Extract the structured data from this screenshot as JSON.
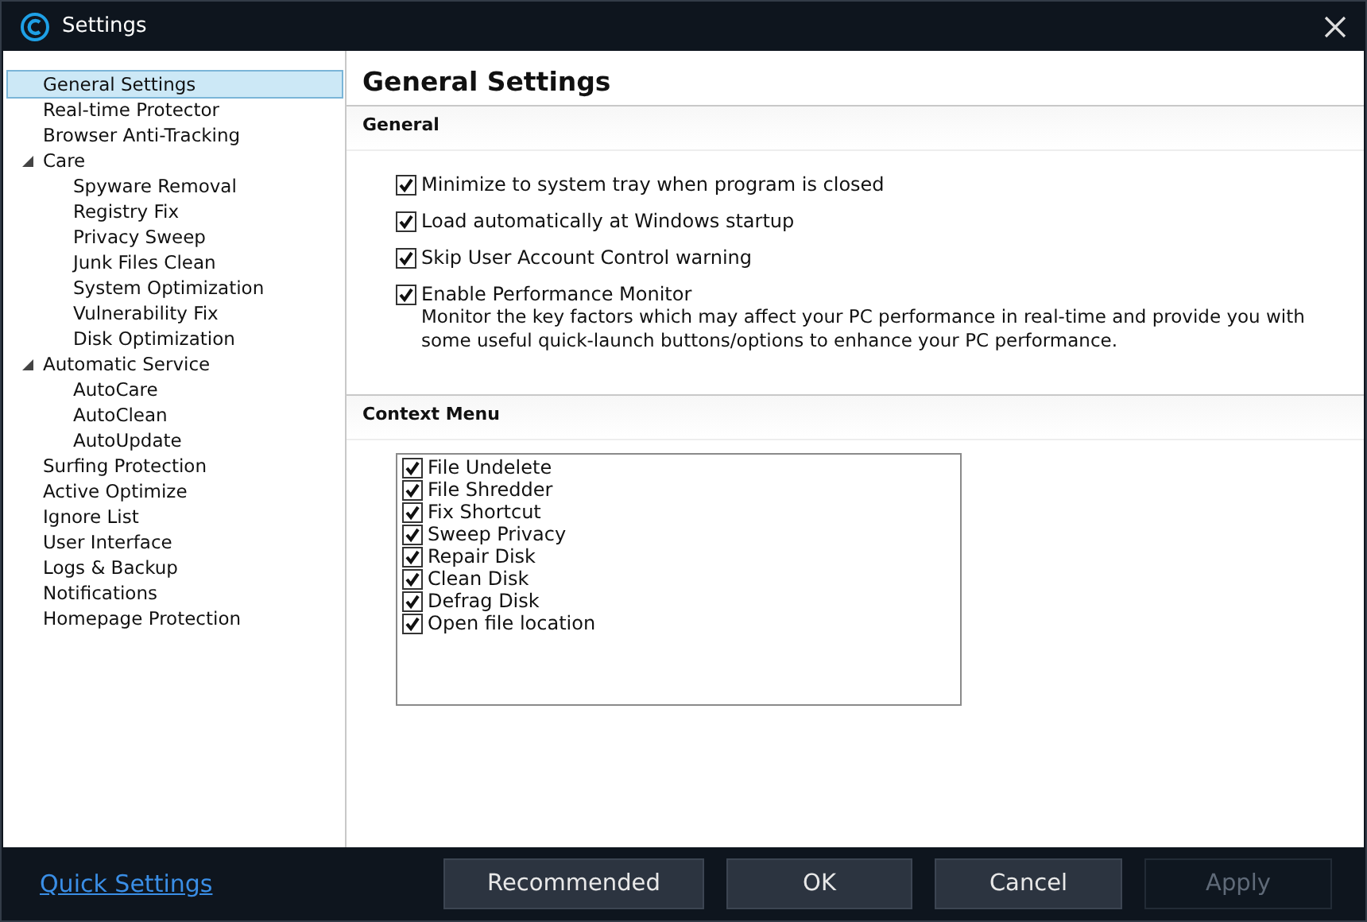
{
  "window": {
    "title": "Settings"
  },
  "sidebar": {
    "items": [
      {
        "label": "General Settings",
        "selected": true
      },
      {
        "label": "Real-time Protector",
        "selected": false
      },
      {
        "label": "Browser Anti-Tracking",
        "selected": false
      },
      {
        "label": "Care",
        "selected": false,
        "expanded": true,
        "children": [
          {
            "label": "Spyware Removal",
            "selected": false
          },
          {
            "label": "Registry Fix",
            "selected": false
          },
          {
            "label": "Privacy Sweep",
            "selected": false
          },
          {
            "label": "Junk Files Clean",
            "selected": false
          },
          {
            "label": "System Optimization",
            "selected": false
          },
          {
            "label": "Vulnerability Fix",
            "selected": false
          },
          {
            "label": "Disk Optimization",
            "selected": false
          }
        ]
      },
      {
        "label": "Automatic Service",
        "selected": false,
        "expanded": true,
        "children": [
          {
            "label": "AutoCare",
            "selected": false
          },
          {
            "label": "AutoClean",
            "selected": false
          },
          {
            "label": "AutoUpdate",
            "selected": false
          }
        ]
      },
      {
        "label": "Surfing Protection",
        "selected": false
      },
      {
        "label": "Active Optimize",
        "selected": false
      },
      {
        "label": "Ignore List",
        "selected": false
      },
      {
        "label": "User Interface",
        "selected": false
      },
      {
        "label": "Logs & Backup",
        "selected": false
      },
      {
        "label": "Notifications",
        "selected": false
      },
      {
        "label": "Homepage Protection",
        "selected": false
      }
    ]
  },
  "content": {
    "title": "General Settings",
    "general": {
      "heading": "General",
      "options": [
        {
          "label": "Minimize to system tray when program is closed",
          "checked": true
        },
        {
          "label": "Load automatically at Windows startup",
          "checked": true
        },
        {
          "label": "Skip User Account Control warning",
          "checked": true
        },
        {
          "label": "Enable Performance Monitor",
          "checked": true,
          "description": "Monitor the key factors which may affect your PC performance in real-time and provide you with some useful quick-launch buttons/options to enhance your PC performance."
        }
      ]
    },
    "context_menu": {
      "heading": "Context Menu",
      "items": [
        {
          "label": "File Undelete",
          "checked": true
        },
        {
          "label": "File Shredder",
          "checked": true
        },
        {
          "label": "Fix Shortcut",
          "checked": true
        },
        {
          "label": "Sweep Privacy",
          "checked": true
        },
        {
          "label": "Repair Disk",
          "checked": true
        },
        {
          "label": "Clean Disk",
          "checked": true
        },
        {
          "label": "Defrag Disk",
          "checked": true
        },
        {
          "label": "Open file location",
          "checked": true
        }
      ]
    }
  },
  "footer": {
    "link": "Quick Settings",
    "buttons": [
      {
        "label": "Recommended",
        "disabled": false
      },
      {
        "label": "OK",
        "disabled": false
      },
      {
        "label": "Cancel",
        "disabled": false
      },
      {
        "label": "Apply",
        "disabled": true
      }
    ]
  }
}
